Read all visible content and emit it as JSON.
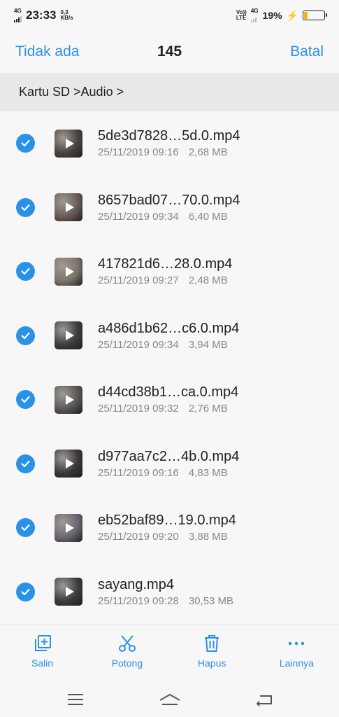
{
  "status_bar": {
    "network_left": "4G",
    "time": "23:33",
    "speed_value": "0,3",
    "speed_unit": "KB/s",
    "volte_top": "Vo))",
    "volte_bottom": "LTE",
    "network_right": "4G",
    "battery_percent": "19%",
    "battery_level": 0.19,
    "battery_color": "#f5b400"
  },
  "title_bar": {
    "left_action": "Tidak ada",
    "count": "145",
    "right_action": "Batal"
  },
  "breadcrumb": "Kartu SD >Audio >",
  "files": [
    {
      "name": "5de3d7828…5d.0.mp4",
      "date": "25/11/2019 09:16",
      "size": "2,68 MB",
      "selected": true,
      "thumb_color": "#4a4440"
    },
    {
      "name": "8657bad07…70.0.mp4",
      "date": "25/11/2019 09:34",
      "size": "6,40 MB",
      "selected": true,
      "thumb_color": "#6a5a55"
    },
    {
      "name": "417821d6…28.0.mp4",
      "date": "25/11/2019 09:27",
      "size": "2,48 MB",
      "selected": true,
      "thumb_color": "#7d7468"
    },
    {
      "name": "a486d1b62…c6.0.mp4",
      "date": "25/11/2019 09:34",
      "size": "3,94 MB",
      "selected": true,
      "thumb_color": "#3d3d3d"
    },
    {
      "name": "d44cd38b1…ca.0.mp4",
      "date": "25/11/2019 09:32",
      "size": "2,76 MB",
      "selected": true,
      "thumb_color": "#5a5555"
    },
    {
      "name": "d977aa7c2…4b.0.mp4",
      "date": "25/11/2019 09:16",
      "size": "4,83 MB",
      "selected": true,
      "thumb_color": "#3a3838"
    },
    {
      "name": "eb52baf89…19.0.mp4",
      "date": "25/11/2019 09:20",
      "size": "3,88 MB",
      "selected": true,
      "thumb_color": "#6b6670"
    },
    {
      "name": "sayang.mp4",
      "date": "25/11/2019 09:28",
      "size": "30,53 MB",
      "selected": true,
      "thumb_color": "#3c3c3c"
    }
  ],
  "actions": [
    {
      "label": "Salin",
      "icon": "copy-icon"
    },
    {
      "label": "Potong",
      "icon": "scissors-icon"
    },
    {
      "label": "Hapus",
      "icon": "trash-icon"
    },
    {
      "label": "Lainnya",
      "icon": "more-icon"
    }
  ],
  "nav": [
    {
      "icon": "menu-icon"
    },
    {
      "icon": "home-icon"
    },
    {
      "icon": "back-icon"
    }
  ],
  "colors": {
    "accent": "#2a91e8",
    "breadcrumb_bg": "#e8e8e8",
    "background": "#f7f7f7"
  }
}
